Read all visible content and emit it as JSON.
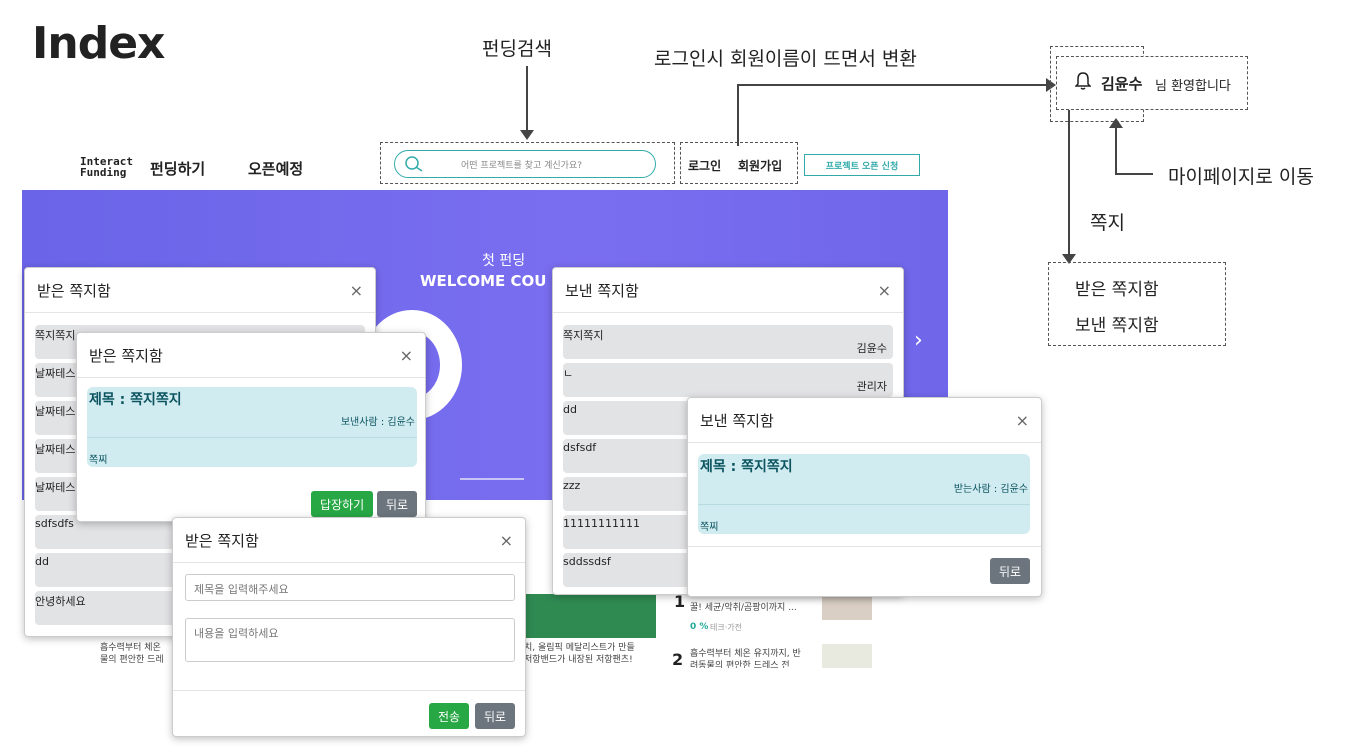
{
  "page_title": "Index",
  "annotations": {
    "search_label": "펀딩검색",
    "login_note": "로그인시 회원이름이 뜨면서 변환",
    "mypage_note": "마이페이지로 이동",
    "message_label": "쪽지",
    "welcome_name": "김윤수",
    "welcome_suffix": "님 환영합니다",
    "menu": [
      "받은 쪽지함",
      "보낸 쪽지함"
    ]
  },
  "nav": {
    "logo_line1": "Interact",
    "logo_line2": "Funding",
    "items": [
      "펀딩하기",
      "오픈예정"
    ],
    "search_placeholder": "어떤 프로젝트를 찾고 계신가요?",
    "login": "로그인",
    "signup": "회원가입",
    "open_request": "프로젝트 오픈 신청"
  },
  "hero": {
    "line1": "첫 펀딩",
    "line2": "WELCOME COU"
  },
  "inbox_list": {
    "title": "받은 쪽지함",
    "items": [
      "쪽지쪽지",
      "날짜테스",
      "날짜테스",
      "날짜테스",
      "날짜테스",
      "sdfsdfs",
      "dd",
      "안녕하세요"
    ]
  },
  "inbox_detail": {
    "title": "받은 쪽지함",
    "subject": "제목 : 쪽지쪽지",
    "sender": "보낸사람 : 김윤수",
    "body": "쪽찌",
    "reply": "답장하기",
    "back": "뒤로"
  },
  "reply_form": {
    "title": "받은 쪽지함",
    "subject_placeholder": "제목을 입력해주세요",
    "body_placeholder": "내용을 입력하세요",
    "send": "전송",
    "back": "뒤로"
  },
  "sent_list": {
    "title": "보낸 쪽지함",
    "items": [
      {
        "t": "쪽지쪽지",
        "r": "김윤수"
      },
      {
        "t": "ㄴ",
        "r": "관리자"
      },
      {
        "t": "dd",
        "r": ""
      },
      {
        "t": "dsfsdf",
        "r": ""
      },
      {
        "t": "zzz",
        "r": ""
      },
      {
        "t": "11111111111",
        "r": ""
      },
      {
        "t": "sddssdsf",
        "r": ""
      }
    ]
  },
  "sent_detail": {
    "title": "보낸 쪽지함",
    "subject": "제목 : 쪽지쪽지",
    "receiver": "받는사람 : 김윤수",
    "body": "쪽찌",
    "back": "뒤로"
  },
  "background_text": {
    "left1": "흡수력부터 체온",
    "left2": "물의 편안한 드레",
    "mid1": "치, 올림픽 메달리스트가 만들",
    "mid2": "저항밴드가 내장된 저항팬츠!",
    "rank1_text": "꿀! 세균/악취/곰팡이까지 ...",
    "rank1_pct": "0 %",
    "rank1_cat": "테크·가전",
    "rank2_num": "2",
    "rank2_text": "흡수력부터 체온 유지까지, 반",
    "rank2_text2": "려동물의 편안한 드레스 전",
    "rank1_num": "1"
  },
  "close_symbol": "×",
  "next_arrow": "›"
}
